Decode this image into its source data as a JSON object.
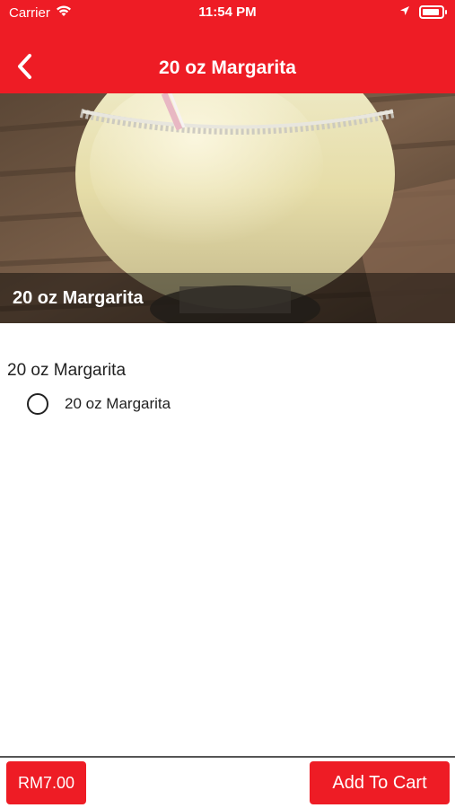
{
  "status_bar": {
    "carrier": "Carrier",
    "time": "11:54 PM",
    "icons": [
      "wifi-icon",
      "location-arrow-icon",
      "battery-icon"
    ]
  },
  "navbar": {
    "title": "20 oz Margarita",
    "back_icon": "chevron-left-icon"
  },
  "hero": {
    "caption": "20 oz Margarita"
  },
  "options": {
    "group_title": "20 oz Margarita",
    "items": [
      {
        "label": "20 oz Margarita",
        "selected": false
      }
    ]
  },
  "footer": {
    "price": "RM7.00",
    "add_to_cart": "Add To Cart"
  },
  "colors": {
    "brand_red": "#ee1c25",
    "text": "#222222",
    "white": "#ffffff"
  }
}
